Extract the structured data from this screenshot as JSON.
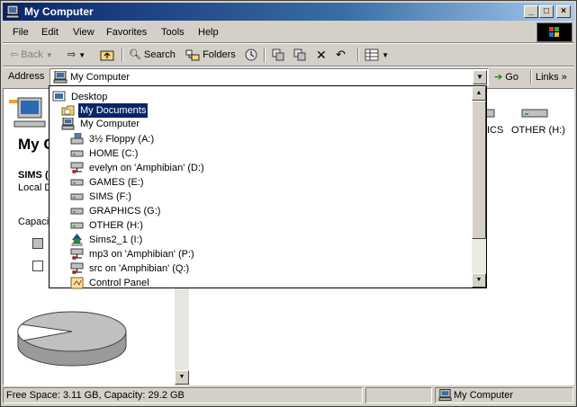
{
  "window": {
    "title": "My Computer"
  },
  "menu": [
    "File",
    "Edit",
    "View",
    "Favorites",
    "Tools",
    "Help"
  ],
  "toolbar": {
    "back_label": "Back",
    "search_label": "Search",
    "folders_label": "Folders"
  },
  "address": {
    "label": "Address",
    "value": "My Computer",
    "go_label": "Go",
    "links_label": "Links"
  },
  "left_pane": {
    "title": "My C",
    "subtitle": "SIMS (",
    "subtitle2": "Local Di",
    "capacity_label": "Capacit"
  },
  "right_drives": [
    {
      "label": "HICS"
    },
    {
      "label": "OTHER (H:)"
    }
  ],
  "dropdown_items": [
    {
      "label": "Desktop",
      "icon": "desktop-icon",
      "level": 0
    },
    {
      "label": "My Documents",
      "icon": "folder-icon",
      "level": 1,
      "selected": true
    },
    {
      "label": "My Computer",
      "icon": "computer-icon",
      "level": 1
    },
    {
      "label": "3½ Floppy (A:)",
      "icon": "floppy-icon",
      "level": 2
    },
    {
      "label": "HOME (C:)",
      "icon": "drive-icon",
      "level": 2
    },
    {
      "label": "evelyn on 'Amphibian' (D:)",
      "icon": "network-drive-icon",
      "level": 2
    },
    {
      "label": "GAMES (E:)",
      "icon": "drive-icon",
      "level": 2
    },
    {
      "label": "SIMS (F:)",
      "icon": "drive-icon",
      "level": 2
    },
    {
      "label": "GRAPHICS (G:)",
      "icon": "drive-icon",
      "level": 2
    },
    {
      "label": "OTHER (H:)",
      "icon": "drive-icon",
      "level": 2
    },
    {
      "label": "Sims2_1 (I:)",
      "icon": "cd-drive-icon",
      "level": 2
    },
    {
      "label": "mp3 on 'Amphibian' (P:)",
      "icon": "network-drive-icon",
      "level": 2
    },
    {
      "label": "src on 'Amphibian' (Q:)",
      "icon": "network-drive-icon",
      "level": 2
    },
    {
      "label": "Control Panel",
      "icon": "control-panel-icon",
      "level": 2
    }
  ],
  "status": {
    "left": "Free Space: 3.11 GB, Capacity: 29.2 GB",
    "right": "My Computer"
  }
}
